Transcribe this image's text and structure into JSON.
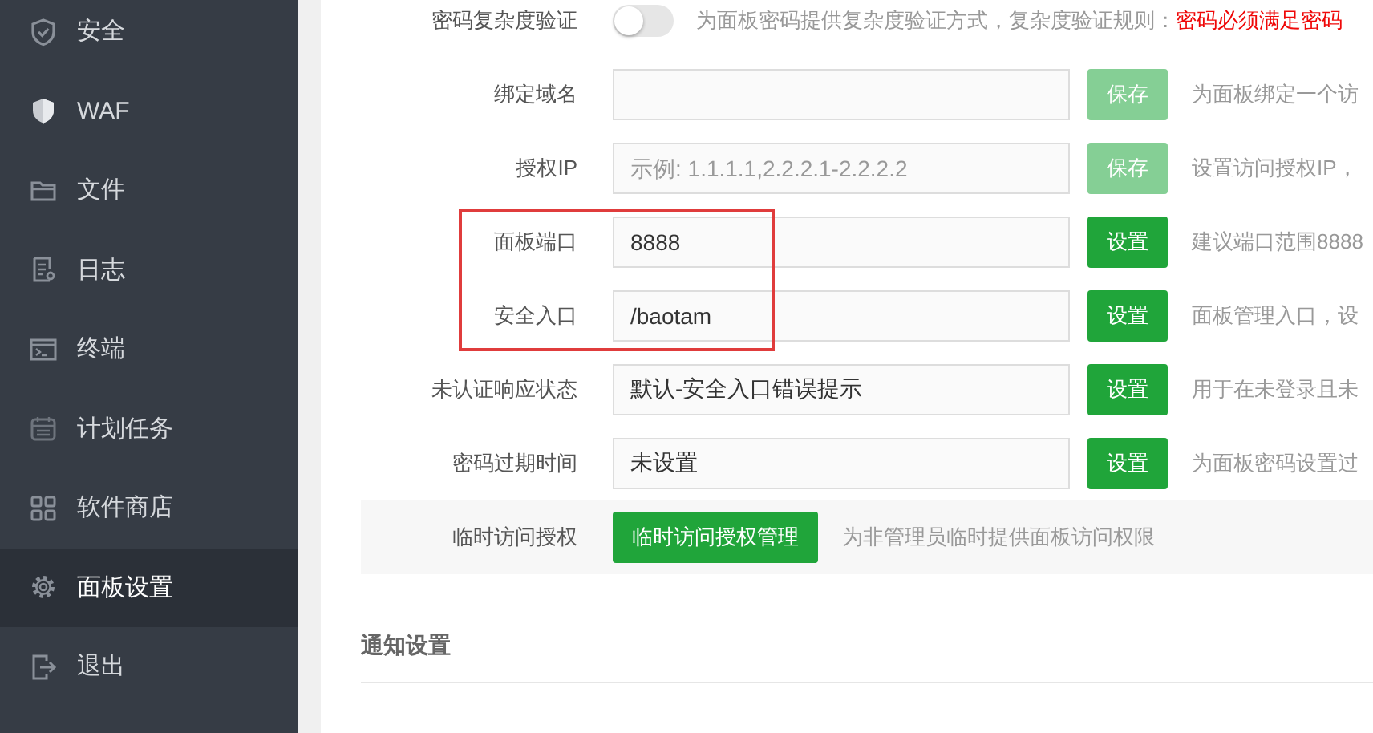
{
  "sidebar": {
    "items": [
      {
        "label": "安全",
        "selected": false
      },
      {
        "label": "WAF",
        "selected": false
      },
      {
        "label": "文件",
        "selected": false
      },
      {
        "label": "日志",
        "selected": false
      },
      {
        "label": "终端",
        "selected": false
      },
      {
        "label": "计划任务",
        "selected": false
      },
      {
        "label": "软件商店",
        "selected": false
      },
      {
        "label": "面板设置",
        "selected": true
      },
      {
        "label": "退出",
        "selected": false
      }
    ]
  },
  "settings": {
    "rows": [
      {
        "kind": "toggle",
        "label": "密码复杂度验证",
        "on": false,
        "hint": "为面板密码提供复杂度验证方式，复杂度验证规则：",
        "warning": "密码必须满足密码"
      },
      {
        "kind": "input",
        "label": "绑定域名",
        "button": {
          "label": "保存",
          "disabled": true
        },
        "hint": "为面板绑定一个访",
        "highlighted": false
      },
      {
        "kind": "input",
        "label": "授权IP",
        "placeholder": "示例: 1.1.1.1,2.2.2.1-2.2.2.2",
        "button": {
          "label": "保存",
          "disabled": true
        },
        "hint": "设置访问授权IP，",
        "highlighted": false
      },
      {
        "kind": "input",
        "label": "面板端口",
        "value": "8888",
        "button": {
          "label": "设置",
          "disabled": false
        },
        "hint": "建议端口范围8888",
        "highlighted": true
      },
      {
        "kind": "input",
        "label": "安全入口",
        "value": "/baotam",
        "button": {
          "label": "设置",
          "disabled": false
        },
        "hint": "面板管理入口，设",
        "highlighted": true
      },
      {
        "kind": "input",
        "label": "未认证响应状态",
        "value": "默认-安全入口错误提示",
        "button": {
          "label": "设置",
          "disabled": false
        },
        "hint": "用于在未登录且未",
        "highlighted": false
      },
      {
        "kind": "input",
        "label": "密码过期时间",
        "value": "未设置",
        "button": {
          "label": "设置",
          "disabled": false
        },
        "hint": "为面板密码设置过",
        "highlighted": false
      },
      {
        "kind": "action",
        "label": "临时访问授权",
        "button": {
          "label": "临时访问授权管理",
          "disabled": false
        },
        "hint": "为非管理员临时提供面板访问权限"
      }
    ]
  },
  "section": {
    "title": "通知设置"
  }
}
